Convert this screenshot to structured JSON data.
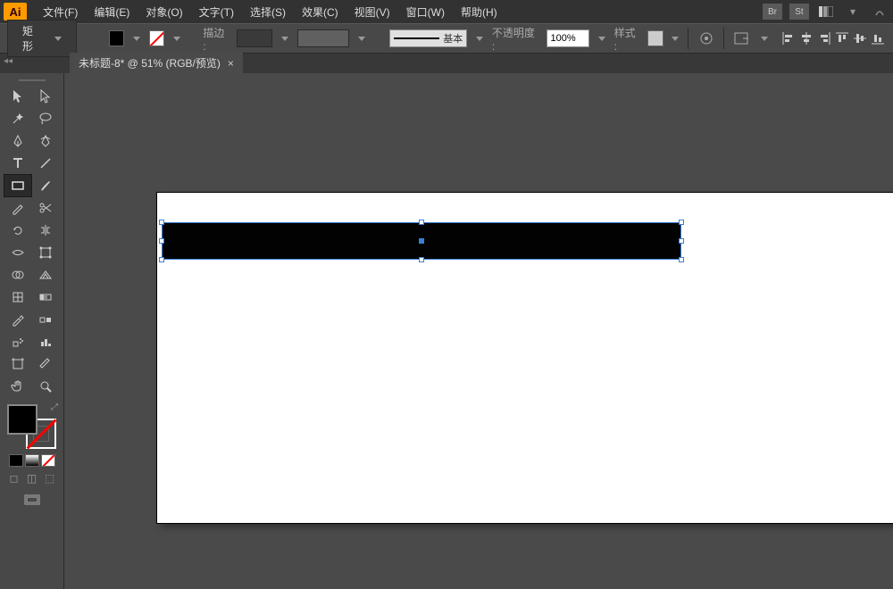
{
  "app": {
    "logo": "Ai"
  },
  "menu": {
    "file": "文件(F)",
    "edit": "编辑(E)",
    "object": "对象(O)",
    "type": "文字(T)",
    "select": "选择(S)",
    "effect": "效果(C)",
    "view": "视图(V)",
    "window": "窗口(W)",
    "help": "帮助(H)",
    "bridge": "Br",
    "stock": "St"
  },
  "control": {
    "shape": "矩形",
    "stroke_label": "描边 :",
    "stroke_style_label": "基本",
    "opacity_label": "不透明度 :",
    "opacity_value": "100%",
    "style_label": "样式 :"
  },
  "document": {
    "tab_title": "未标题-8* @ 51% (RGB/预览)"
  },
  "colors": {
    "fill": "#000000",
    "stroke": "none",
    "selection_border": "#3b7fd4"
  }
}
